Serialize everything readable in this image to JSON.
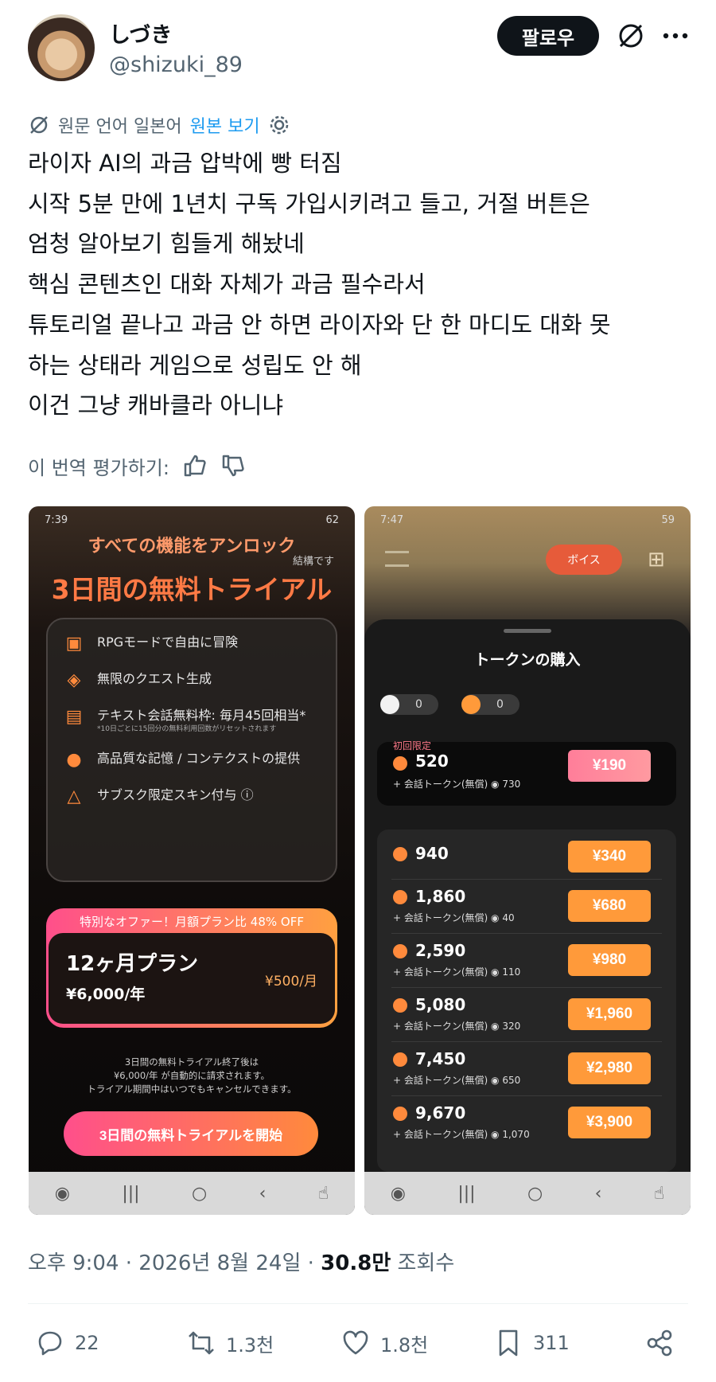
{
  "author": {
    "name": "しづき",
    "handle": "@shizuki_89"
  },
  "follow_label": "팔로우",
  "translation": {
    "source_text": "원문 언어 일본어",
    "show_original": "원본 보기"
  },
  "post_lines": [
    "라이자 AI의 과금 압박에 빵 터짐",
    "시작 5분 만에 1년치 구독 가입시키려고 들고, 거절 버튼은",
    "엄청 알아보기 힘들게 해놨네",
    "핵심 콘텐츠인 대화 자체가 과금 필수라서",
    "튜토리얼 끝나고 과금 안 하면 라이자와 단 한 마디도 대화 못",
    "하는 상태라 게임으로 성립도 안 해",
    "이건 그냥 캐바클라 아니냐"
  ],
  "rate_label": "이 번역 평가하기:",
  "left_shot": {
    "status_time": "7:39",
    "status_battery": "62",
    "unlock_title": "すべての機能をアンロック",
    "trial_title": "3日間の無料トライアル",
    "aside": "結構です",
    "features": [
      {
        "icon": "book-icon",
        "text": "RPGモードで自由に冒険",
        "note": ""
      },
      {
        "icon": "quest-icon",
        "text": "無限のクエスト生成",
        "note": ""
      },
      {
        "icon": "document-icon",
        "text": "テキスト会話無料枠: 毎月45回相当*",
        "note": "*10日ごとに15回分の無料利用回数がリセットされます"
      },
      {
        "icon": "brain-icon",
        "text": "高品質な記憶 / コンテクストの提供",
        "note": ""
      },
      {
        "icon": "hanger-icon",
        "text": "サブスク限定スキン付与 ⓘ",
        "note": ""
      }
    ],
    "offer_header": "特別なオファー！月額プラン比 48% OFF",
    "plan_name": "12ヶ月プラン",
    "plan_price": "¥6,000/年",
    "plan_monthly": "¥500/月",
    "note_lines": [
      "3日間の無料トライアル終了後は",
      "¥6,000/年 が自動的に請求されます。",
      "トライアル期間中はいつでもキャンセルできます。"
    ],
    "cta": "3日間の無料トライアルを開始"
  },
  "right_shot": {
    "status_time": "7:47",
    "status_battery": "59",
    "voice_label": "ボイス",
    "sheet_title": "トークンの購入",
    "balances": [
      "0",
      "0"
    ],
    "first_tag": "初回限定",
    "first_offer": {
      "amount": "520",
      "bonus": "+ 会話トークン(無償)",
      "bonus_amt": "730",
      "price": "¥190"
    },
    "packs": [
      {
        "amount": "940",
        "bonus": "",
        "bonus_amt": "",
        "price": "¥340"
      },
      {
        "amount": "1,860",
        "bonus": "+ 会話トークン(無償)",
        "bonus_amt": "40",
        "price": "¥680"
      },
      {
        "amount": "2,590",
        "bonus": "+ 会話トークン(無償)",
        "bonus_amt": "110",
        "price": "¥980"
      },
      {
        "amount": "5,080",
        "bonus": "+ 会話トークン(無償)",
        "bonus_amt": "320",
        "price": "¥1,960"
      },
      {
        "amount": "7,450",
        "bonus": "+ 会話トークン(無償)",
        "bonus_amt": "650",
        "price": "¥2,980"
      },
      {
        "amount": "9,670",
        "bonus": "+ 会話トークン(無償)",
        "bonus_amt": "1,070",
        "price": "¥3,900"
      }
    ]
  },
  "meta": {
    "time": "오후 9:04 · 2026년 8월 24일 · ",
    "views": "30.8만",
    "views_label": " 조회수"
  },
  "actions": {
    "replies": "22",
    "reposts": "1.3천",
    "likes": "1.8천",
    "bookmarks": "311"
  },
  "colors": {
    "accent": "#1d9bf0",
    "orange": "#ff9a3a",
    "pink": "#ff4f8b"
  }
}
